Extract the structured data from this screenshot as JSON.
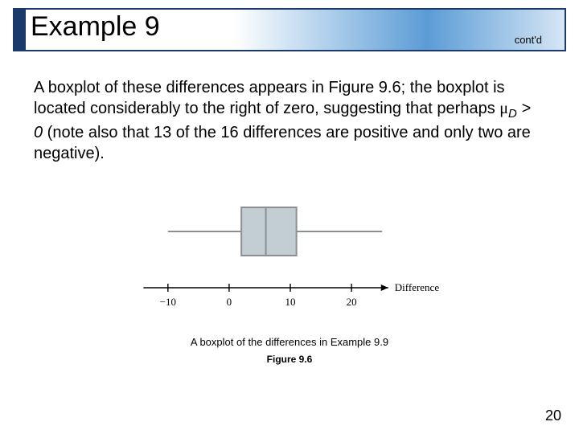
{
  "header": {
    "title": "Example 9",
    "contd": "cont'd"
  },
  "body": {
    "p1_a": "A boxplot of these differences appears in Figure 9.6; the boxplot is located considerably to the right of zero, suggesting that perhaps ",
    "mu": "μ",
    "sub": "D",
    "gt": " > 0",
    "p1_b": " (note also that 13 of the 16 differences are positive and only two are negative)."
  },
  "caption": "A boxplot of the differences in Example 9.9",
  "figure_label": "Figure 9.6",
  "page": "20",
  "chart_data": {
    "type": "boxplot",
    "title": "A boxplot of the differences in Example 9.9",
    "xlabel": "Difference",
    "axis_ticks": [
      -10,
      0,
      10,
      20
    ],
    "box": {
      "whisker_low": -10,
      "q1": 2,
      "median": 6,
      "q3": 11,
      "whisker_high": 25
    }
  }
}
